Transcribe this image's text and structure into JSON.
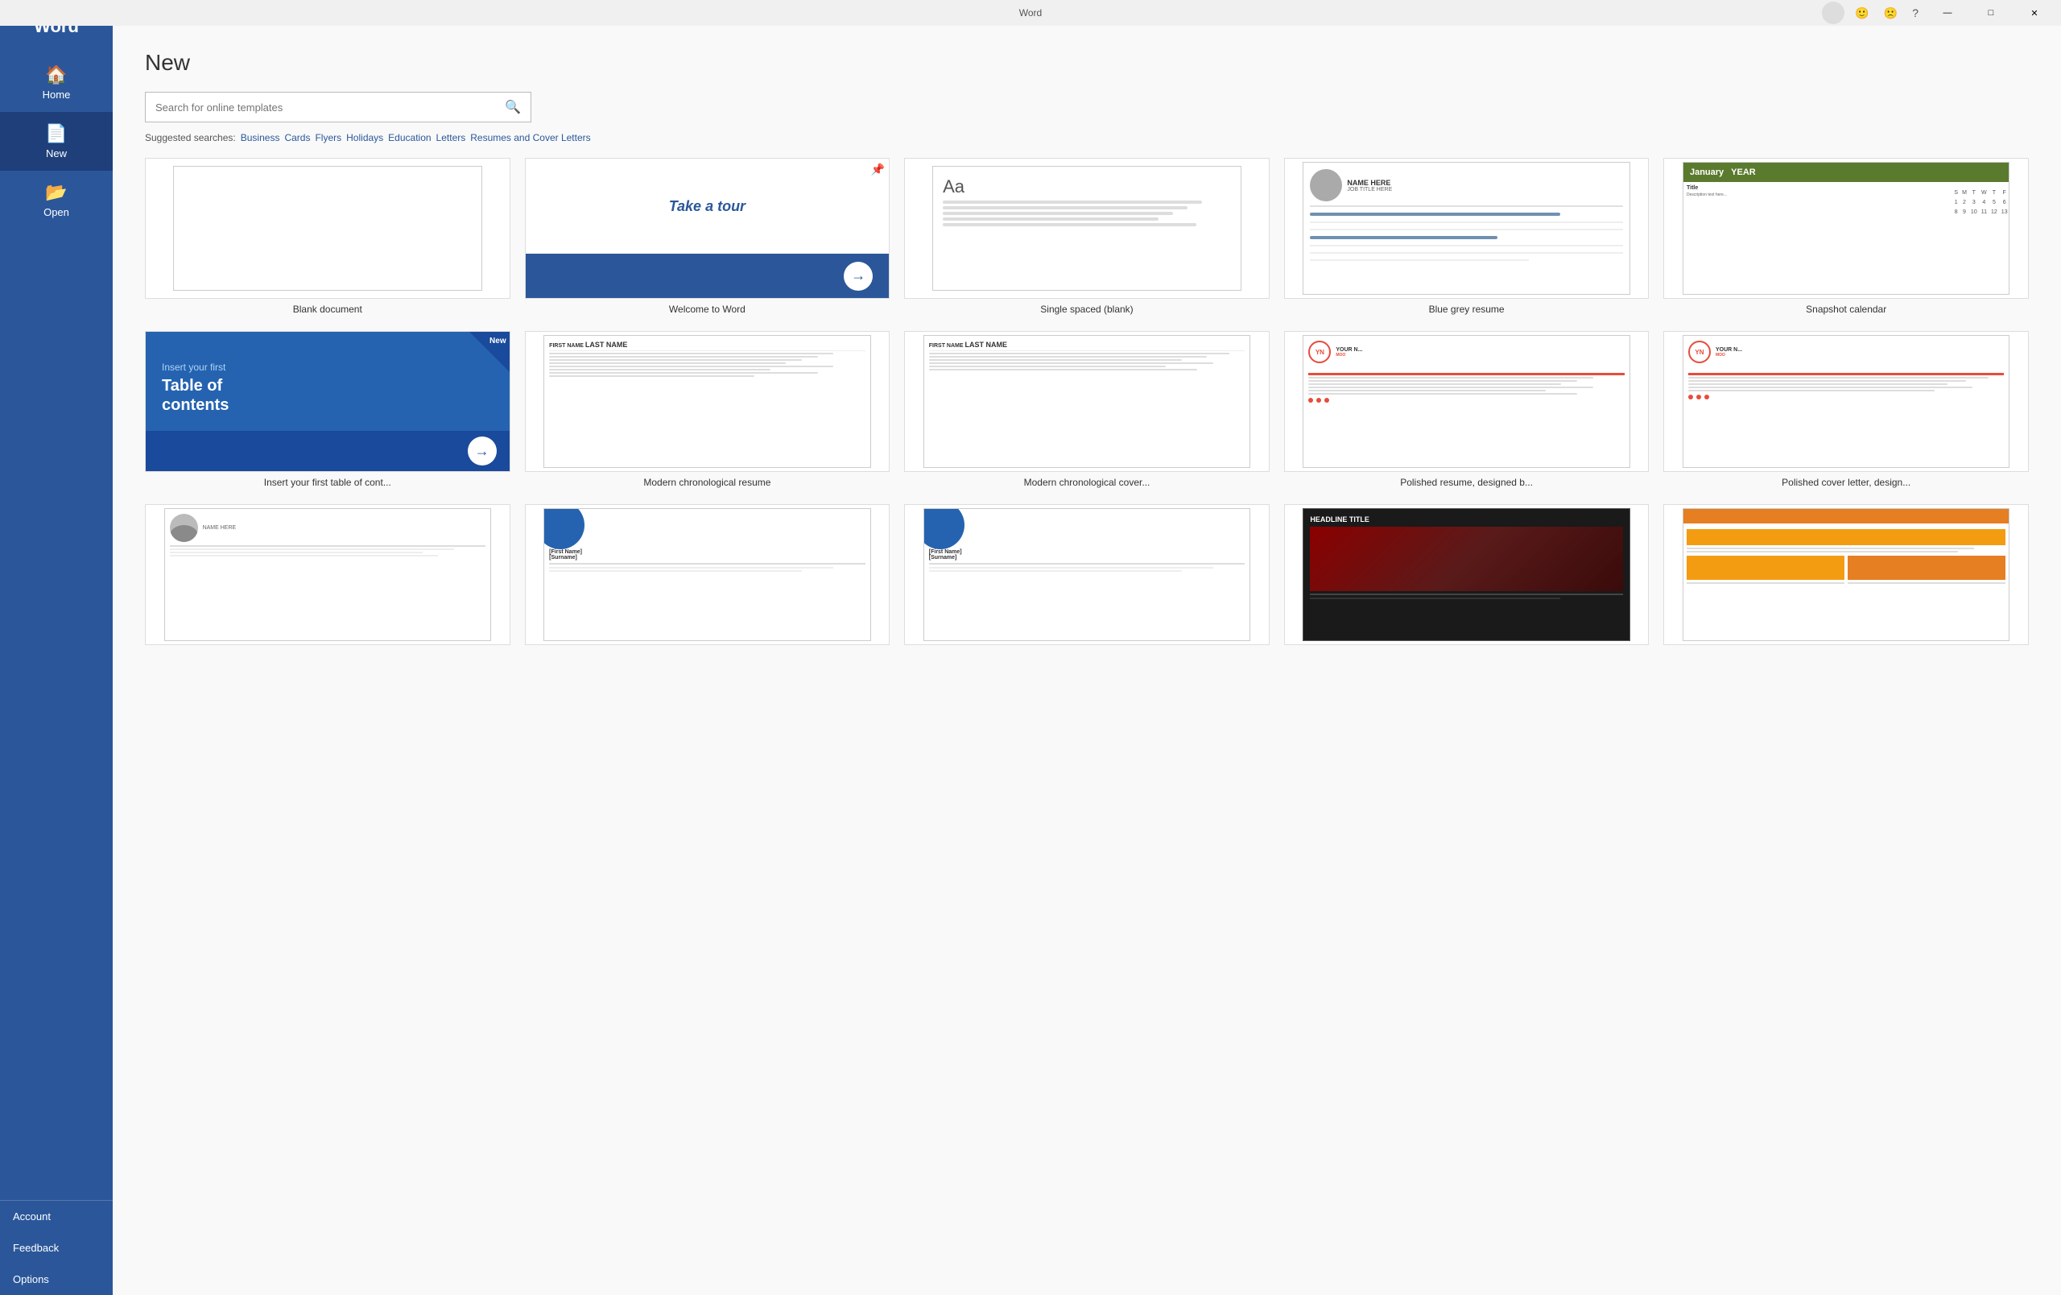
{
  "titlebar": {
    "app_name": "Word",
    "minimize": "—",
    "maximize": "□",
    "close": "✕"
  },
  "sidebar": {
    "title": "Word",
    "home_label": "Home",
    "new_label": "New",
    "open_label": "Open",
    "account_label": "Account",
    "feedback_label": "Feedback",
    "options_label": "Options"
  },
  "main": {
    "page_title": "New",
    "search_placeholder": "Search for online templates",
    "suggested_label": "Suggested searches:",
    "suggestions": [
      "Business",
      "Cards",
      "Flyers",
      "Holidays",
      "Education",
      "Letters",
      "Resumes and Cover Letters"
    ],
    "templates": [
      {
        "id": "blank",
        "label": "Blank document"
      },
      {
        "id": "tour",
        "label": "Welcome to Word"
      },
      {
        "id": "single",
        "label": "Single spaced (blank)"
      },
      {
        "id": "blue-resume",
        "label": "Blue grey resume"
      },
      {
        "id": "calendar",
        "label": "Snapshot calendar"
      },
      {
        "id": "toc",
        "label": "Insert your first table of cont..."
      },
      {
        "id": "modern-resume",
        "label": "Modern chronological resume"
      },
      {
        "id": "modern-cover",
        "label": "Modern chronological cover..."
      },
      {
        "id": "polished-resume",
        "label": "Polished resume, designed b..."
      },
      {
        "id": "polished-cover",
        "label": "Polished cover letter, design..."
      }
    ],
    "tour_text": "Take a tour",
    "toc_insert": "Insert your first",
    "toc_big": "Table of\ncontents",
    "calendar_month": "January",
    "calendar_year": "YEAR",
    "new_badge": "New",
    "resume_firstname": "FIRST NAME",
    "resume_lastname": "LAST NAME",
    "resume_yn": "YN",
    "moo_label": "MOO"
  }
}
